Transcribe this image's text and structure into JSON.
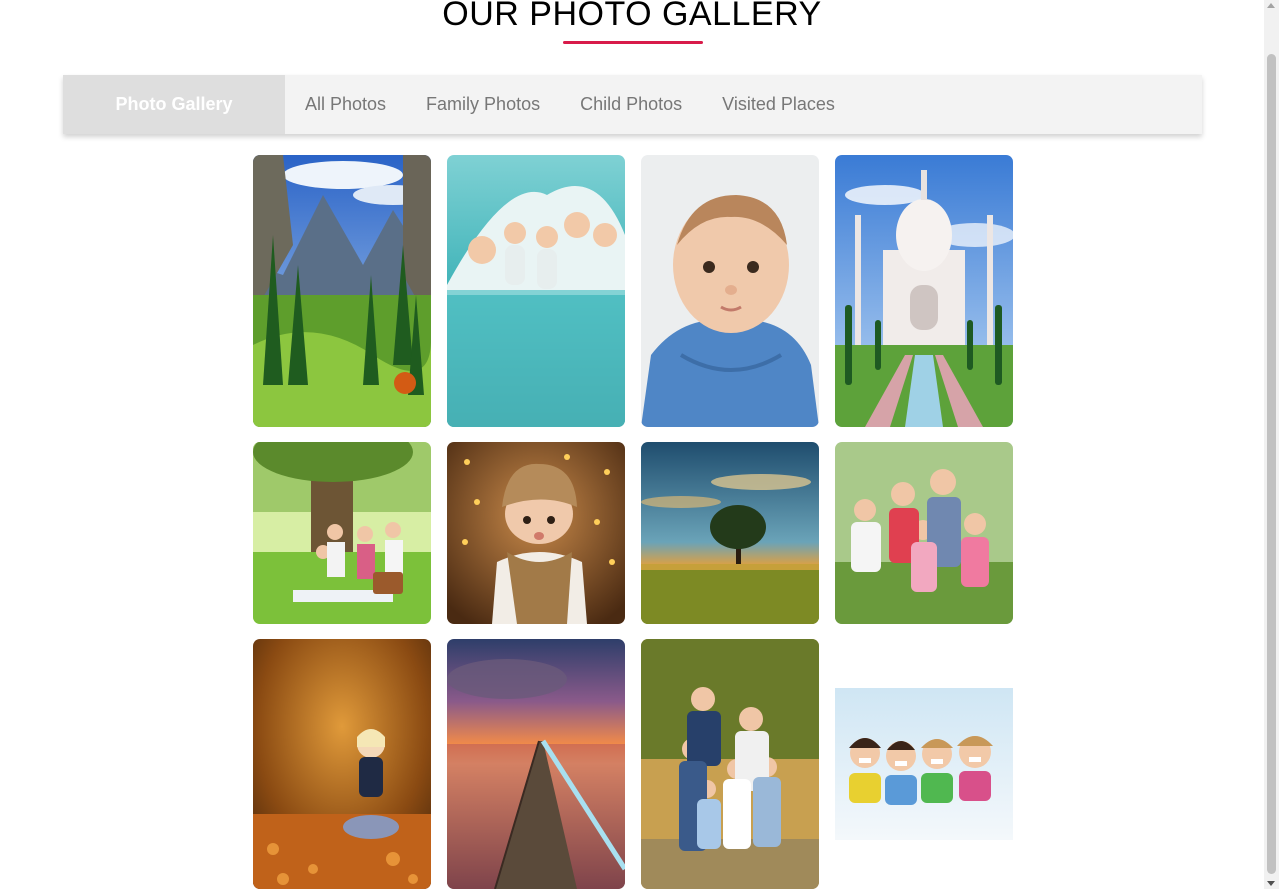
{
  "page": {
    "title": "OUR PHOTO GALLERY"
  },
  "nav": {
    "brand": "Photo Gallery",
    "links": [
      "All Photos",
      "Family Photos",
      "Child Photos",
      "Visited Places"
    ]
  },
  "gallery": {
    "photos": [
      {
        "name": "mountain-landscape-photo",
        "category": "Visited Places"
      },
      {
        "name": "family-under-blanket-photo",
        "category": "Family Photos"
      },
      {
        "name": "baby-portrait-photo",
        "category": "Child Photos"
      },
      {
        "name": "taj-mahal-photo",
        "category": "Visited Places"
      },
      {
        "name": "family-picnic-photo",
        "category": "Family Photos"
      },
      {
        "name": "baby-in-knit-hat-photo",
        "category": "Child Photos"
      },
      {
        "name": "tree-sunset-field-photo",
        "category": "Visited Places"
      },
      {
        "name": "family-in-park-photo",
        "category": "Family Photos"
      },
      {
        "name": "child-in-autumn-leaves-photo",
        "category": "Child Photos"
      },
      {
        "name": "pier-sunset-photo",
        "category": "Visited Places"
      },
      {
        "name": "family-of-six-photo",
        "category": "Family Photos"
      },
      {
        "name": "four-kids-smiling-photo",
        "category": "Child Photos"
      }
    ]
  },
  "colors": {
    "accent": "#d81b4a",
    "navbar_bg": "#f3f3f3",
    "brand_bg": "#dedede",
    "nav_text": "#777777"
  }
}
